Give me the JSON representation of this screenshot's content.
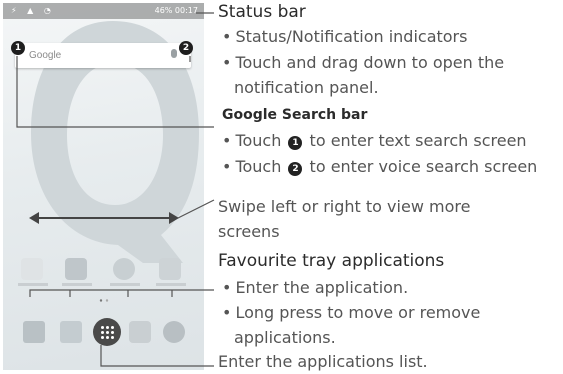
{
  "phone": {
    "status_time": "46% 00:17",
    "search_placeholder": "Google",
    "badge_1": "1",
    "badge_2": "2"
  },
  "annotations": {
    "status_bar": {
      "title": "Status bar",
      "items": [
        "Status/Notification indicators",
        "Touch and drag down to open the",
        "notification panel."
      ]
    },
    "google_search": {
      "title": "Google Search bar",
      "item1_pre": "Touch",
      "item1_num": "1",
      "item1_post": "to enter text search screen",
      "item2_pre": "Touch",
      "item2_num": "2",
      "item2_post": "to enter voice search screen"
    },
    "swipe": {
      "line1": "Swipe left or right to view more",
      "line2": "screens"
    },
    "favourite": {
      "title": "Favourite tray applications",
      "items": [
        "Enter the application.",
        "Long press to move or remove",
        "applications."
      ]
    },
    "app_list": "Enter the applications list."
  },
  "colors": {
    "callout_line": "#555555",
    "text_primary": "#2b2b2b",
    "text_secondary": "#555555"
  }
}
